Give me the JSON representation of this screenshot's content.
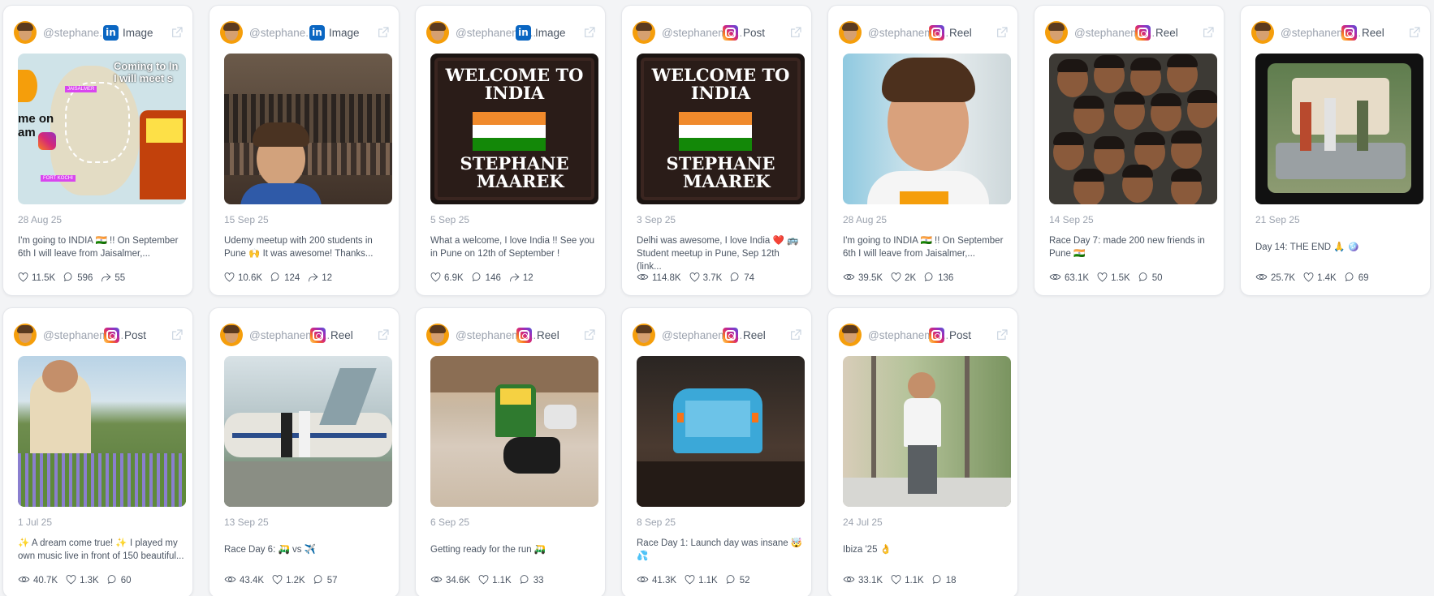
{
  "posts": [
    {
      "handle": "@stephane...",
      "platform": "linkedin",
      "type": "Image",
      "date": "28 Aug 25",
      "caption": "I'm going to INDIA 🇮🇳 !! On September\n6th I will leave from Jaisalmer,...",
      "stats": [
        {
          "icon": "heart-icon",
          "value": "11.5K"
        },
        {
          "icon": "comment-icon",
          "value": "596"
        },
        {
          "icon": "share-icon",
          "value": "55"
        }
      ],
      "image_alt": "Map of India travel route"
    },
    {
      "handle": "@stephane...",
      "platform": "linkedin",
      "type": "Image",
      "date": "15 Sep 25",
      "caption": "Udemy meetup with 200 students in\nPune 🙌 It was awesome! Thanks...",
      "stats": [
        {
          "icon": "heart-icon",
          "value": "10.6K"
        },
        {
          "icon": "comment-icon",
          "value": "124"
        },
        {
          "icon": "share-icon",
          "value": "12"
        }
      ],
      "image_alt": "Selfie with audience in hall"
    },
    {
      "handle": "@stephanema...",
      "platform": "linkedin",
      "type": "Image",
      "date": "5 Sep 25",
      "caption": "What a welcome, I love India !! See you\nin Pune on 12th of September !",
      "stats": [
        {
          "icon": "heart-icon",
          "value": "6.9K"
        },
        {
          "icon": "comment-icon",
          "value": "146"
        },
        {
          "icon": "share-icon",
          "value": "12"
        }
      ],
      "image_alt": "Welcome to India cake"
    },
    {
      "handle": "@stephanema...",
      "platform": "instagram",
      "type": "Post",
      "date": "3 Sep 25",
      "caption": "Delhi was awesome, I love India ❤️ 🚌\nStudent meetup in Pune, Sep 12th (link...",
      "stats": [
        {
          "icon": "eye-icon",
          "value": "114.8K"
        },
        {
          "icon": "heart-icon",
          "value": "3.7K"
        },
        {
          "icon": "comment-icon",
          "value": "74"
        }
      ],
      "image_alt": "Welcome to India cake"
    },
    {
      "handle": "@stephanema...",
      "platform": "instagram",
      "type": "Reel",
      "date": "28 Aug 25",
      "caption": "I'm going to INDIA 🇮🇳 !! On September\n6th I will leave from Jaisalmer,...",
      "stats": [
        {
          "icon": "eye-icon",
          "value": "39.5K"
        },
        {
          "icon": "heart-icon",
          "value": "2K"
        },
        {
          "icon": "comment-icon",
          "value": "136"
        }
      ],
      "image_alt": "Smiling man portrait"
    },
    {
      "handle": "@stephanema...",
      "platform": "instagram",
      "type": "Reel",
      "date": "14 Sep 25",
      "caption": "Race Day 7: made 200 new friends in\nPune 🇮🇳",
      "stats": [
        {
          "icon": "eye-icon",
          "value": "63.1K"
        },
        {
          "icon": "heart-icon",
          "value": "1.5K"
        },
        {
          "icon": "comment-icon",
          "value": "50"
        }
      ],
      "image_alt": "Group selfie crowd"
    },
    {
      "handle": "@stephanema...",
      "platform": "instagram",
      "type": "Reel",
      "date": "21 Sep 25",
      "caption": "Day 14: THE END 🙏 🪩",
      "stats": [
        {
          "icon": "eye-icon",
          "value": "25.7K"
        },
        {
          "icon": "heart-icon",
          "value": "1.4K"
        },
        {
          "icon": "comment-icon",
          "value": "69"
        }
      ],
      "image_alt": "People celebrating by rickshaw"
    },
    {
      "handle": "@stephanema...",
      "platform": "instagram",
      "type": "Post",
      "date": "1 Jul 25",
      "caption": "✨ A dream come true! ✨ I played my\nown music live in front of 150 beautiful...",
      "stats": [
        {
          "icon": "eye-icon",
          "value": "40.7K"
        },
        {
          "icon": "heart-icon",
          "value": "1.3K"
        },
        {
          "icon": "comment-icon",
          "value": "60"
        }
      ],
      "image_alt": "Man among lavender in mountains"
    },
    {
      "handle": "@stephanema...",
      "platform": "instagram",
      "type": "Reel",
      "date": "13 Sep 25",
      "caption": "Race Day 6: 🛺 vs ✈️",
      "stats": [
        {
          "icon": "eye-icon",
          "value": "43.4K"
        },
        {
          "icon": "heart-icon",
          "value": "1.2K"
        },
        {
          "icon": "comment-icon",
          "value": "57"
        }
      ],
      "image_alt": "Couple on old airplane"
    },
    {
      "handle": "@stephanema...",
      "platform": "instagram",
      "type": "Reel",
      "date": "6 Sep 25",
      "caption": "Getting ready for the run 🛺",
      "stats": [
        {
          "icon": "eye-icon",
          "value": "34.6K"
        },
        {
          "icon": "heart-icon",
          "value": "1.1K"
        },
        {
          "icon": "comment-icon",
          "value": "33"
        }
      ],
      "image_alt": "Street with rickshaw and scooter"
    },
    {
      "handle": "@stephanema...",
      "platform": "instagram",
      "type": "Reel",
      "date": "8 Sep 25",
      "caption": "Race Day 1: Launch day was insane 🤯\n💦",
      "stats": [
        {
          "icon": "eye-icon",
          "value": "41.3K"
        },
        {
          "icon": "heart-icon",
          "value": "1.1K"
        },
        {
          "icon": "comment-icon",
          "value": "52"
        }
      ],
      "image_alt": "Rickshaw in rain at night"
    },
    {
      "handle": "@stephanema...",
      "platform": "instagram",
      "type": "Post",
      "date": "24 Jul 25",
      "caption": "Ibiza '25 👌",
      "stats": [
        {
          "icon": "eye-icon",
          "value": "33.1K"
        },
        {
          "icon": "heart-icon",
          "value": "1.1K"
        },
        {
          "icon": "comment-icon",
          "value": "18"
        }
      ],
      "image_alt": "Man standing behind glass door"
    }
  ]
}
